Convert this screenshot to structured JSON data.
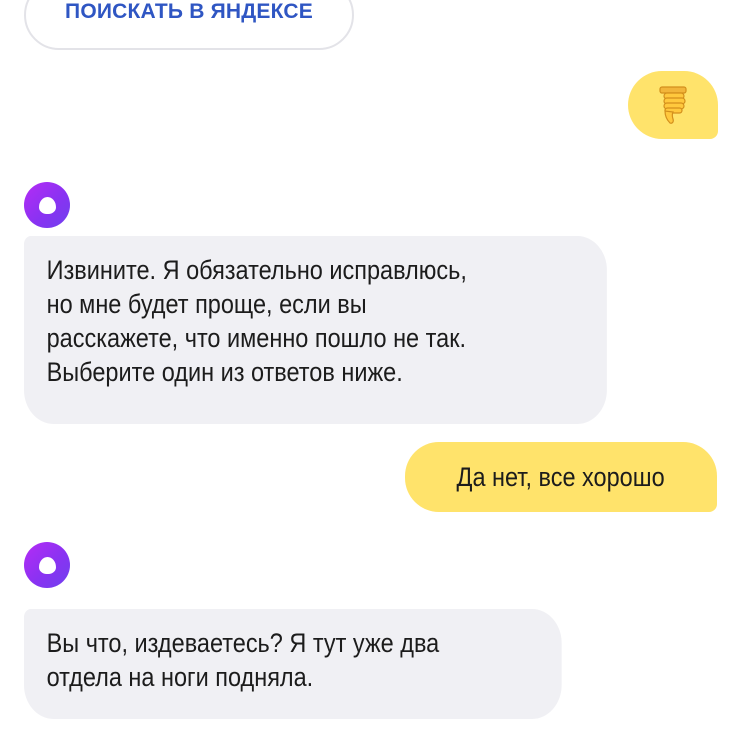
{
  "search_button": {
    "label": "ПОИСКАТЬ В ЯНДЕКСЕ"
  },
  "messages": [
    {
      "from": "user",
      "type": "icon",
      "icon": "thumbs-down-emoji"
    },
    {
      "from": "assistant",
      "avatar": "alice-logo-icon",
      "lines": [
        "Извините. Я обязательно исправлюсь,",
        "но мне будет проще, если вы",
        "расскажете, что именно пошло не так.",
        "Выберите один из ответов ниже."
      ]
    },
    {
      "from": "user",
      "type": "text",
      "text": "Да нет, все хорошо"
    },
    {
      "from": "assistant",
      "avatar": "alice-logo-icon",
      "lines": [
        "Вы что, издеваетесь? Я тут уже два",
        "отдела на ноги подняла."
      ]
    }
  ],
  "colors": {
    "user_bubble": "#ffe36b",
    "assistant_bubble": "#f0f0f4",
    "link_blue": "#2f56c3",
    "alice_purple": "#8a32f2"
  }
}
